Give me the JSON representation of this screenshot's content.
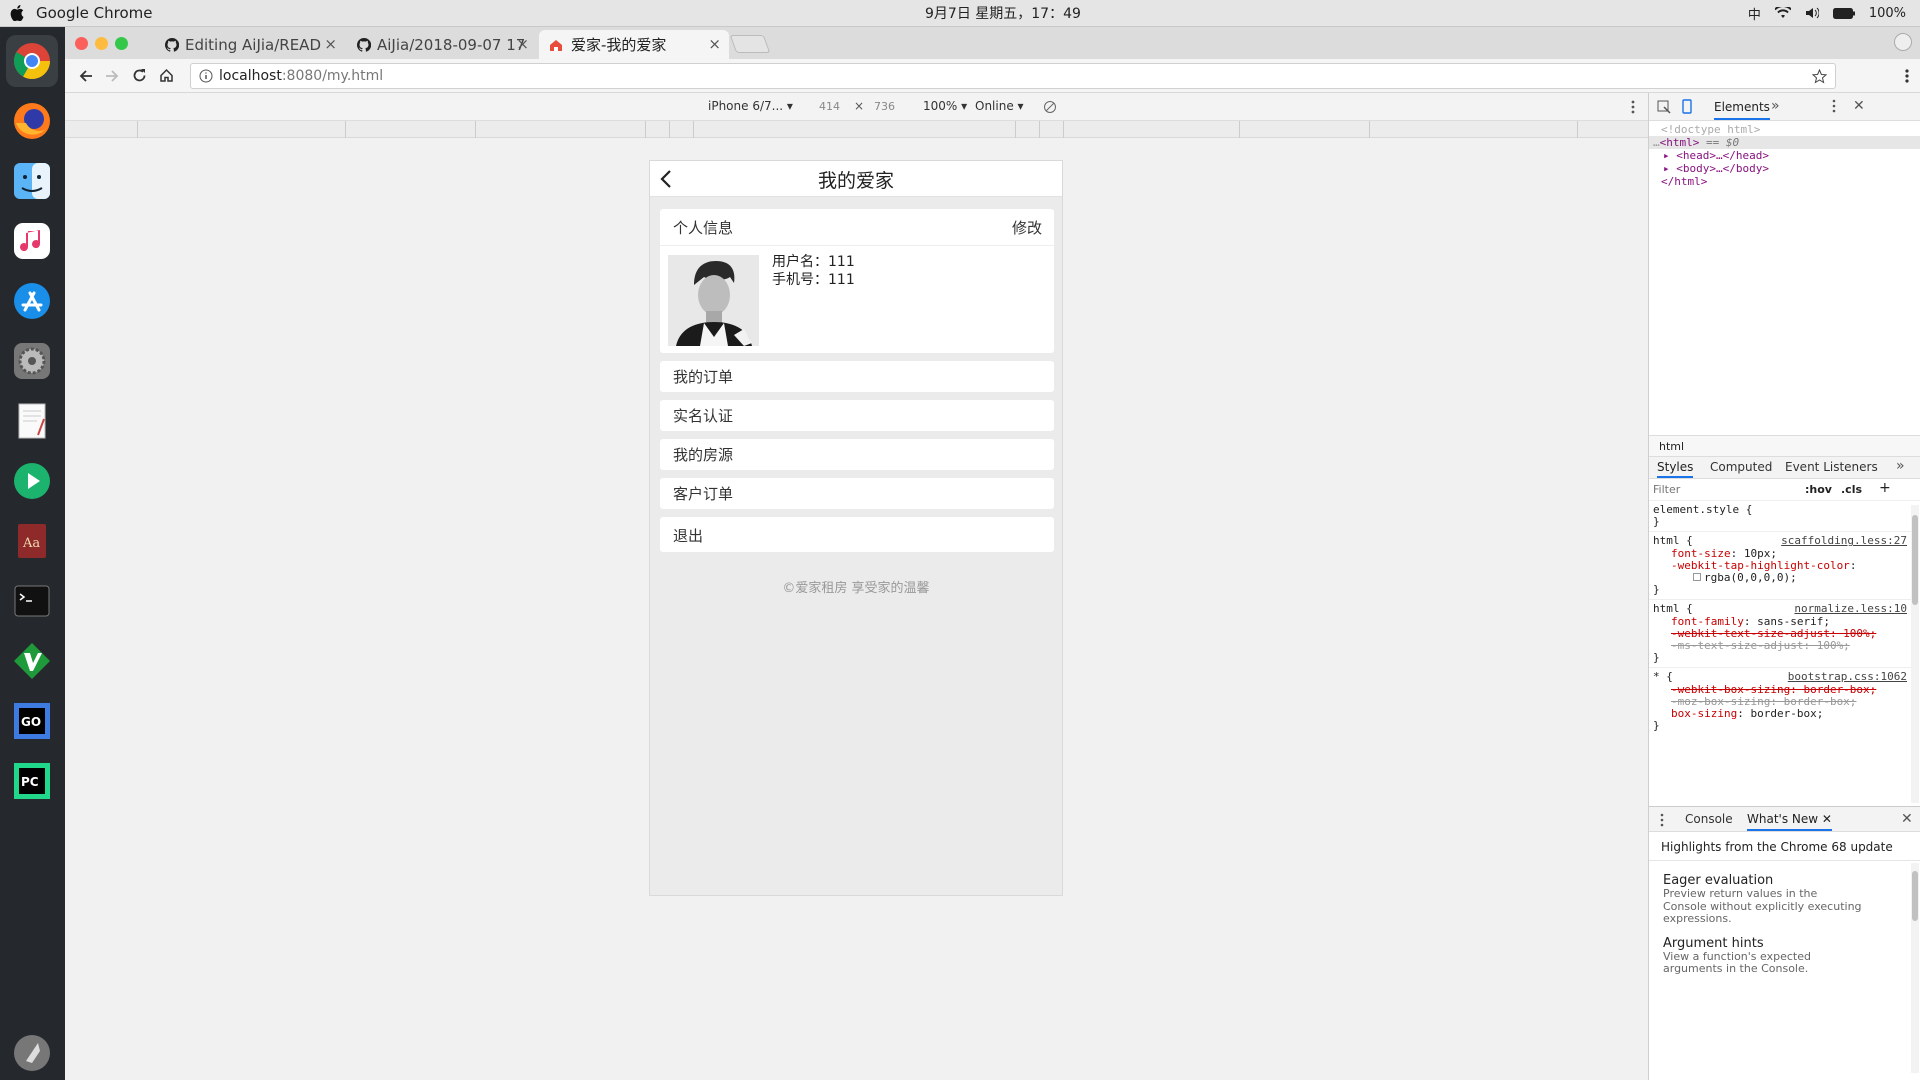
{
  "system": {
    "app_name": "Google Chrome",
    "clock": "9月7日 星期五，17：49",
    "input_method": "中",
    "battery": "100%"
  },
  "dock": {
    "items": [
      "chrome-icon",
      "firefox-icon",
      "finder-icon",
      "itunes-icon",
      "app-store-icon",
      "system-preferences-icon",
      "textedit-icon",
      "infuse-icon",
      "dictionary-icon",
      "terminal-icon",
      "vim-icon",
      "goland-icon",
      "pycharm-icon",
      "launchpad-icon"
    ]
  },
  "tabs": [
    {
      "label": "Editing AiJia/READ"
    },
    {
      "label": "AiJia/2018-09-07 17"
    },
    {
      "label": "爱家-我的爱家"
    }
  ],
  "toolbar": {
    "url_host": "localhost",
    "url_rest": ":8080/my.html"
  },
  "device": {
    "model": "iPhone 6/7...",
    "width": "414",
    "x": "×",
    "height": "736",
    "zoom": "100%",
    "network": "Online"
  },
  "page": {
    "title": "我的爱家",
    "profile": {
      "heading": "个人信息",
      "edit": "修改",
      "username_label": "用户名：",
      "username": "111",
      "phone_label": "手机号：",
      "phone": "111"
    },
    "menu": [
      "我的订单",
      "实名认证",
      "我的房源",
      "客户订单"
    ],
    "logout": "退出",
    "footer": "©爱家租房  享受家的温馨"
  },
  "devtools": {
    "tab_elements": "Elements",
    "dom": {
      "doctype": "<!doctype html>",
      "html_open": "<html>",
      "html_sel": "== $0",
      "head": "<head>…</head>",
      "body": "<body>…</body>",
      "html_close": "</html>"
    },
    "breadcrumb": "html",
    "panel_tabs": [
      "Styles",
      "Computed",
      "Event Listeners"
    ],
    "filter_placeholder": "Filter",
    "hov": ":hov",
    "cls": ".cls",
    "styles": {
      "element_style": "element.style {",
      "close": "}",
      "r1_sel": "html {",
      "r1_src": "scaffolding.less:27",
      "r1_p1": "font-size",
      "r1_v1": "10px;",
      "r1_p2": "-webkit-tap-highlight-color",
      "r1_v2": "rgba(0,0,0,0);",
      "r2_sel": "html {",
      "r2_src": "normalize.less:10",
      "r2_p1": "font-family",
      "r2_v1": "sans-serif;",
      "r2_p2": "-webkit-text-size-adjust: 100%;",
      "r2_p3": "-ms-text-size-adjust: 100%;",
      "r3_sel": "* {",
      "r3_src": "bootstrap.css:1062",
      "r3_p1": "-webkit-box-sizing: border-box;",
      "r3_p2": "-moz-box-sizing: border-box;",
      "r3_p3": "box-sizing",
      "r3_v3": "border-box;"
    },
    "drawer_tabs": [
      "Console",
      "What's New"
    ],
    "whats_new": {
      "headline": "Highlights from the Chrome 68 update",
      "items": [
        {
          "title": "Eager evaluation",
          "desc": "Preview return values in the Console without explicitly executing expressions."
        },
        {
          "title": "Argument hints",
          "desc": "View a function's expected arguments in the Console."
        }
      ]
    }
  }
}
